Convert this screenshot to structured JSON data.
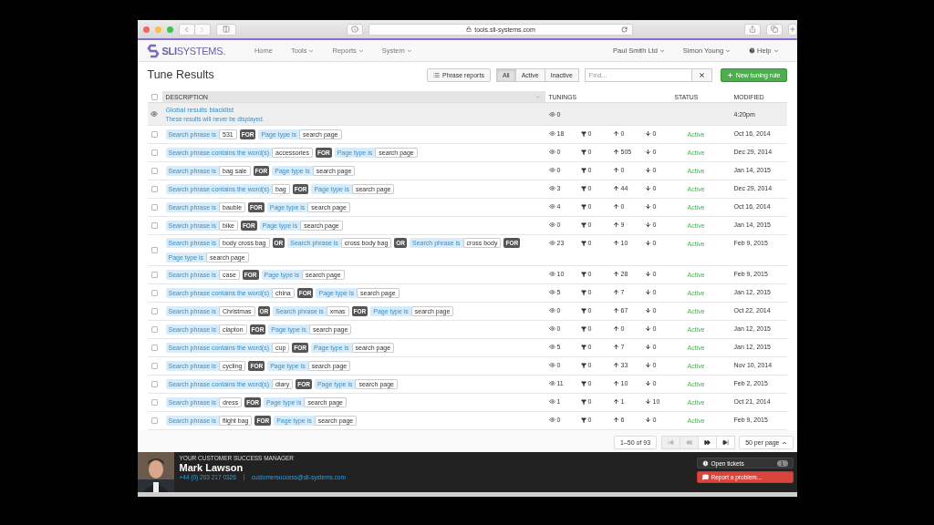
{
  "browser": {
    "url": "tools.sli-systems.com"
  },
  "nav": {
    "logo_brand": "SLI",
    "logo_rest": "SYSTEMS.",
    "items": [
      {
        "label": "Home",
        "dropdown": false
      },
      {
        "label": "Tools",
        "dropdown": true
      },
      {
        "label": "Reports",
        "dropdown": true
      },
      {
        "label": "System",
        "dropdown": true
      }
    ],
    "right_items": [
      {
        "label": "Paul Smith Ltd",
        "kind": "plain"
      },
      {
        "label": "Simon Young",
        "kind": "plain"
      },
      {
        "label": "Help",
        "kind": "help"
      }
    ]
  },
  "page": {
    "title": "Tune Results",
    "phrase_reports": "Phrase reports",
    "filters": [
      {
        "label": "All",
        "selected": true
      },
      {
        "label": "Active",
        "selected": false
      },
      {
        "label": "Inactive",
        "selected": false
      }
    ],
    "search": {
      "placeholder": "Find..."
    },
    "new_button": "New tuning rule"
  },
  "table": {
    "select_all": {
      "checked": false
    },
    "columns": [
      "DESCRIPTION",
      "TUNINGS",
      "STATUS",
      "MODIFIED"
    ],
    "blacklist": {
      "title": "Global results blacklist",
      "subtitle": "These results will never be displayed.",
      "views": "0",
      "modified": "4:20pm"
    },
    "rows": [
      {
        "checked": false,
        "parts": [
          {
            "kind": "cond",
            "label": "Search phrase is",
            "value": "531"
          },
          {
            "kind": "op",
            "text": "FOR"
          },
          {
            "kind": "cond",
            "label": "Page type is",
            "value": "search page"
          }
        ],
        "views": "18",
        "filtered": "0",
        "boosted": "0",
        "buried": "0",
        "status": "Active",
        "modified": "Oct 16, 2014"
      },
      {
        "checked": false,
        "parts": [
          {
            "kind": "cond",
            "label": "Search phrase contains the word(s)",
            "value": "accessories"
          },
          {
            "kind": "op",
            "text": "FOR"
          },
          {
            "kind": "cond",
            "label": "Page type is",
            "value": "search page"
          }
        ],
        "views": "0",
        "filtered": "0",
        "boosted": "505",
        "buried": "0",
        "status": "Active",
        "modified": "Dec 29, 2014"
      },
      {
        "checked": false,
        "parts": [
          {
            "kind": "cond",
            "label": "Search phrase is",
            "value": "bag sale"
          },
          {
            "kind": "op",
            "text": "FOR"
          },
          {
            "kind": "cond",
            "label": "Page type is",
            "value": "search page"
          }
        ],
        "views": "0",
        "filtered": "0",
        "boosted": "0",
        "buried": "0",
        "status": "Active",
        "modified": "Jan 14, 2015"
      },
      {
        "checked": false,
        "parts": [
          {
            "kind": "cond",
            "label": "Search phrase contains the word(s)",
            "value": "bag"
          },
          {
            "kind": "op",
            "text": "FOR"
          },
          {
            "kind": "cond",
            "label": "Page type is",
            "value": "search page"
          }
        ],
        "views": "3",
        "filtered": "0",
        "boosted": "44",
        "buried": "0",
        "status": "Active",
        "modified": "Dec 29, 2014"
      },
      {
        "checked": false,
        "parts": [
          {
            "kind": "cond",
            "label": "Search phrase is",
            "value": "bauble"
          },
          {
            "kind": "op",
            "text": "FOR"
          },
          {
            "kind": "cond",
            "label": "Page type is",
            "value": "search page"
          }
        ],
        "views": "4",
        "filtered": "0",
        "boosted": "0",
        "buried": "0",
        "status": "Active",
        "modified": "Oct 16, 2014"
      },
      {
        "checked": false,
        "parts": [
          {
            "kind": "cond",
            "label": "Search phrase is",
            "value": "bike"
          },
          {
            "kind": "op",
            "text": "FOR"
          },
          {
            "kind": "cond",
            "label": "Page type is",
            "value": "search page"
          }
        ],
        "views": "0",
        "filtered": "0",
        "boosted": "9",
        "buried": "0",
        "status": "Active",
        "modified": "Jan 14, 2015"
      },
      {
        "checked": false,
        "parts": [
          {
            "kind": "cond",
            "label": "Search phrase is",
            "value": "body cross bag"
          },
          {
            "kind": "op",
            "text": "OR"
          },
          {
            "kind": "cond",
            "label": "Search phrase is",
            "value": "cross body bag"
          },
          {
            "kind": "op",
            "text": "OR"
          },
          {
            "kind": "cond",
            "label": "Search phrase is",
            "value": "cross body"
          },
          {
            "kind": "op",
            "text": "FOR"
          },
          {
            "kind": "cond",
            "label": "Page type is",
            "value": "search page"
          }
        ],
        "views": "23",
        "filtered": "0",
        "boosted": "10",
        "buried": "0",
        "status": "Active",
        "modified": "Feb 9, 2015"
      },
      {
        "checked": false,
        "parts": [
          {
            "kind": "cond",
            "label": "Search phrase is",
            "value": "case"
          },
          {
            "kind": "op",
            "text": "FOR"
          },
          {
            "kind": "cond",
            "label": "Page type is",
            "value": "search page"
          }
        ],
        "views": "10",
        "filtered": "0",
        "boosted": "28",
        "buried": "0",
        "status": "Active",
        "modified": "Feb 9, 2015"
      },
      {
        "checked": false,
        "parts": [
          {
            "kind": "cond",
            "label": "Search phrase contains the word(s)",
            "value": "china"
          },
          {
            "kind": "op",
            "text": "FOR"
          },
          {
            "kind": "cond",
            "label": "Page type is",
            "value": "search page"
          }
        ],
        "views": "5",
        "filtered": "0",
        "boosted": "7",
        "buried": "0",
        "status": "Active",
        "modified": "Jan 12, 2015"
      },
      {
        "checked": false,
        "parts": [
          {
            "kind": "cond",
            "label": "Search phrase is",
            "value": "Christmas"
          },
          {
            "kind": "op",
            "text": "OR"
          },
          {
            "kind": "cond",
            "label": "Search phrase is",
            "value": "xmas"
          },
          {
            "kind": "op",
            "text": "FOR"
          },
          {
            "kind": "cond",
            "label": "Page type is",
            "value": "search page"
          }
        ],
        "views": "0",
        "filtered": "0",
        "boosted": "67",
        "buried": "0",
        "status": "Active",
        "modified": "Oct 22, 2014"
      },
      {
        "checked": false,
        "parts": [
          {
            "kind": "cond",
            "label": "Search phrase is",
            "value": "clapton"
          },
          {
            "kind": "op",
            "text": "FOR"
          },
          {
            "kind": "cond",
            "label": "Page type is",
            "value": "search page"
          }
        ],
        "views": "0",
        "filtered": "0",
        "boosted": "0",
        "buried": "0",
        "status": "Active",
        "modified": "Jan 12, 2015"
      },
      {
        "checked": false,
        "parts": [
          {
            "kind": "cond",
            "label": "Search phrase contains the word(s)",
            "value": "cup"
          },
          {
            "kind": "op",
            "text": "FOR"
          },
          {
            "kind": "cond",
            "label": "Page type is",
            "value": "search page"
          }
        ],
        "views": "5",
        "filtered": "0",
        "boosted": "7",
        "buried": "0",
        "status": "Active",
        "modified": "Jan 12, 2015"
      },
      {
        "checked": false,
        "parts": [
          {
            "kind": "cond",
            "label": "Search phrase is",
            "value": "cycling"
          },
          {
            "kind": "op",
            "text": "FOR"
          },
          {
            "kind": "cond",
            "label": "Page type is",
            "value": "search page"
          }
        ],
        "views": "0",
        "filtered": "0",
        "boosted": "33",
        "buried": "0",
        "status": "Active",
        "modified": "Nov 10, 2014"
      },
      {
        "checked": false,
        "parts": [
          {
            "kind": "cond",
            "label": "Search phrase contains the word(s)",
            "value": "diary"
          },
          {
            "kind": "op",
            "text": "FOR"
          },
          {
            "kind": "cond",
            "label": "Page type is",
            "value": "search page"
          }
        ],
        "views": "11",
        "filtered": "0",
        "boosted": "10",
        "buried": "0",
        "status": "Active",
        "modified": "Feb 2, 2015"
      },
      {
        "checked": false,
        "parts": [
          {
            "kind": "cond",
            "label": "Search phrase is",
            "value": "dress"
          },
          {
            "kind": "op",
            "text": "FOR"
          },
          {
            "kind": "cond",
            "label": "Page type is",
            "value": "search page"
          }
        ],
        "views": "1",
        "filtered": "0",
        "boosted": "1",
        "buried": "10",
        "status": "Active",
        "modified": "Oct 21, 2014"
      },
      {
        "checked": false,
        "parts": [
          {
            "kind": "cond",
            "label": "Search phrase is",
            "value": "flight bag"
          },
          {
            "kind": "op",
            "text": "FOR"
          },
          {
            "kind": "cond",
            "label": "Page type is",
            "value": "search page"
          }
        ],
        "views": "0",
        "filtered": "0",
        "boosted": "6",
        "buried": "0",
        "status": "Active",
        "modified": "Feb 9, 2015"
      }
    ]
  },
  "pagination": {
    "range": "1–50 of 93",
    "buttons": [
      {
        "kind": "first",
        "disabled": true
      },
      {
        "kind": "prev",
        "disabled": true
      },
      {
        "kind": "next",
        "disabled": false
      },
      {
        "kind": "last",
        "disabled": false
      }
    ],
    "per_page": "50 per page"
  },
  "footer": {
    "role": "YOUR CUSTOMER SUCCESS MANAGER",
    "name": "Mark Lawson",
    "phone": "+44 (0) 203 217 0326",
    "email": "customersuccess@sli-systems.com",
    "tickets_label": "Open tickets",
    "tickets_count": "1",
    "report_button": "Report a problem..."
  }
}
